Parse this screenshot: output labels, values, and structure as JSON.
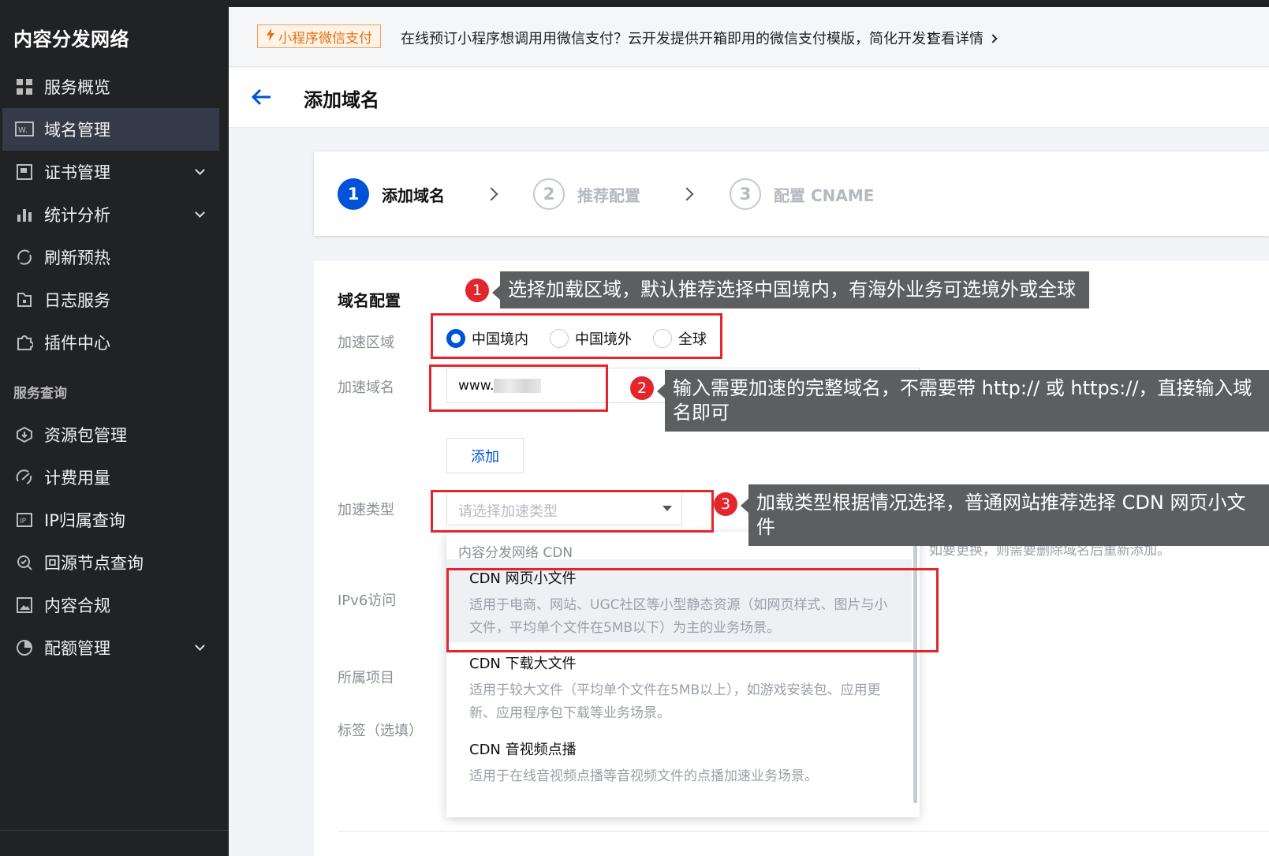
{
  "sidebar": {
    "brand": "内容分发网络",
    "items": [
      {
        "label": "服务概览",
        "icon": "dashboard-icon"
      },
      {
        "label": "域名管理",
        "icon": "domain-icon",
        "active": true
      },
      {
        "label": "证书管理",
        "icon": "certificate-icon",
        "expandable": true
      },
      {
        "label": "统计分析",
        "icon": "bar-chart-icon",
        "expandable": true
      },
      {
        "label": "刷新预热",
        "icon": "refresh-icon"
      },
      {
        "label": "日志服务",
        "icon": "log-icon"
      },
      {
        "label": "插件中心",
        "icon": "plugin-icon"
      }
    ],
    "section_label": "服务查询",
    "query_items": [
      {
        "label": "资源包管理",
        "icon": "package-icon"
      },
      {
        "label": "计费用量",
        "icon": "billing-icon"
      },
      {
        "label": "IP归属查询",
        "icon": "ip-icon"
      },
      {
        "label": "回源节点查询",
        "icon": "search-node-icon"
      },
      {
        "label": "内容合规",
        "icon": "image-icon"
      },
      {
        "label": "配额管理",
        "icon": "quota-icon",
        "expandable": true
      }
    ]
  },
  "notice": {
    "badge": "小程序微信支付",
    "text": "在线预订小程序想调用用微信支付？云开发提供开箱即用的微信支付模版，简化开发！",
    "link": "查看详情"
  },
  "header": {
    "title": "添加域名"
  },
  "steps": [
    {
      "num": "1",
      "label": "添加域名",
      "active": true
    },
    {
      "num": "2",
      "label": "推荐配置",
      "active": false
    },
    {
      "num": "3",
      "label": "配置 CNAME",
      "active": false
    }
  ],
  "form": {
    "section_title": "域名配置",
    "labels": {
      "region": "加速区域",
      "domain": "加速域名",
      "type": "加速类型",
      "ipv6": "IPv6访问",
      "project": "所属项目",
      "tags": "标签（选填）"
    },
    "region_options": [
      {
        "label": "中国境内",
        "checked": true
      },
      {
        "label": "中国境外",
        "checked": false
      },
      {
        "label": "全球",
        "checked": false
      }
    ],
    "domain_value": "www.",
    "add_button": "添加",
    "type_placeholder": "请选择加速类型",
    "hint": "如要更换，则需要删除域名后重新添加。"
  },
  "dropdown": {
    "group": "内容分发网络 CDN",
    "options": [
      {
        "title": "CDN 网页小文件",
        "desc": "适用于电商、网站、UGC社区等小型静态资源（如网页样式、图片与小文件，平均单个文件在5MB以下）为主的业务场景。",
        "selected": true
      },
      {
        "title": "CDN 下载大文件",
        "desc": "适用于较大文件（平均单个文件在5MB以上），如游戏安装包、应用更新、应用程序包下载等业务场景。",
        "selected": false
      },
      {
        "title": "CDN 音视频点播",
        "desc": "适用于在线音视频点播等音视频文件的点播加速业务场景。",
        "selected": false
      }
    ]
  },
  "annotations": [
    {
      "num": "1",
      "text": "选择加载区域，默认推荐选择中国境内，有海外业务可选境外或全球"
    },
    {
      "num": "2",
      "text": "输入需要加速的完整域名，不需要带 http:// 或 https://，直接输入域名即可"
    },
    {
      "num": "3",
      "text": "加载类型根据情况选择，普通网站推荐选择 CDN 网页小文件"
    }
  ],
  "colors": {
    "sidebar_bg": "#212224",
    "primary": "#0052d9",
    "annotation_red": "#e3262c",
    "callout_bg": "#5c5e60"
  }
}
